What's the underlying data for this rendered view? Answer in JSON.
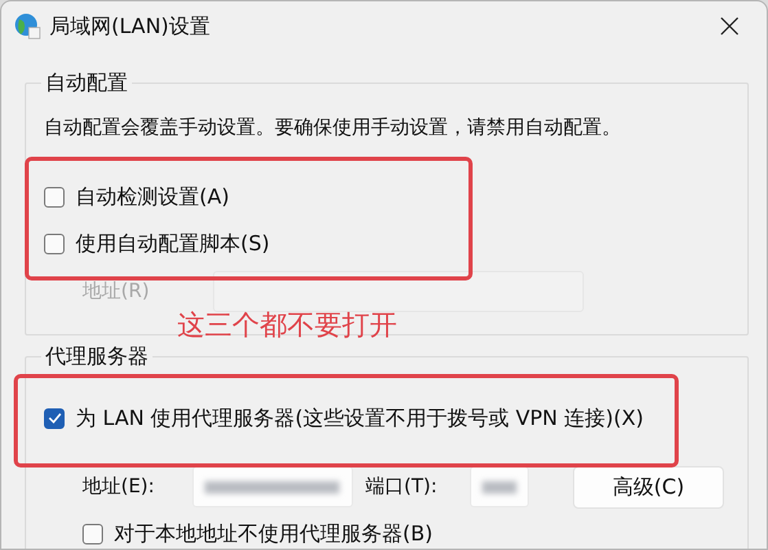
{
  "window": {
    "title": "局域网(LAN)设置"
  },
  "auto_config": {
    "title": "自动配置",
    "description": "自动配置会覆盖手动设置。要确保使用手动设置，请禁用自动配置。",
    "options": [
      {
        "label": "自动检测设置(A)",
        "checked": false
      },
      {
        "label": "使用自动配置脚本(S)",
        "checked": false
      }
    ],
    "address": {
      "label": "地址(R)",
      "disabled": true
    }
  },
  "annotation": {
    "text": "这三个都不要打开"
  },
  "proxy": {
    "title": "代理服务器",
    "use_proxy": {
      "label": "为 LAN 使用代理服务器(这些设置不用于拨号或 VPN 连接)(X)",
      "checked": true
    },
    "address": {
      "label": "地址(E):"
    },
    "port": {
      "label": "端口(T):"
    },
    "advanced_button": "高级(C)",
    "bypass_local": {
      "label": "对于本地地址不使用代理服务器(B)",
      "checked": false
    }
  }
}
